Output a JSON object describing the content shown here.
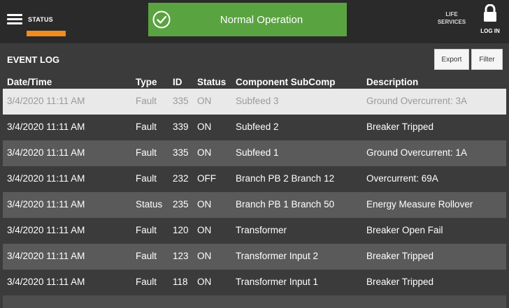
{
  "header": {
    "status_label": "STATUS",
    "banner_text": "Normal Operation",
    "life_services_line1": "LIFE",
    "life_services_line2": "SERVICES",
    "login_label": "LOG IN"
  },
  "colors": {
    "accent_orange": "#f28c1e",
    "status_green": "#5aa341",
    "background": "#3b3b3b",
    "row_alt": "#5a5a5a",
    "row_selected": "#e9e9e9"
  },
  "icons": {
    "menu": "menu-icon",
    "check": "check-circle-icon",
    "lock": "lock-icon"
  },
  "event_log": {
    "title": "EVENT LOG",
    "export_label": "Export",
    "filter_label": "Filter",
    "columns": {
      "datetime": "Date/Time",
      "type": "Type",
      "id": "ID",
      "status": "Status",
      "component": "Component SubComp",
      "description": "Description"
    },
    "rows": [
      {
        "datetime": "3/4/2020 11:11 AM",
        "type": "Fault",
        "id": "335",
        "status": "ON",
        "component": "Subfeed 3",
        "description": "Ground Overcurrent: 3A"
      },
      {
        "datetime": "3/4/2020 11:11 AM",
        "type": "Fault",
        "id": "339",
        "status": "ON",
        "component": "Subfeed 2",
        "description": "Breaker Tripped"
      },
      {
        "datetime": "3/4/2020 11:11 AM",
        "type": "Fault",
        "id": "335",
        "status": "ON",
        "component": "Subfeed 1",
        "description": "Ground Overcurrent: 1A"
      },
      {
        "datetime": "3/4/2020 11:11 AM",
        "type": "Fault",
        "id": "232",
        "status": "OFF",
        "component": "Branch PB 2 Branch 12",
        "description": "Overcurrent: 69A"
      },
      {
        "datetime": "3/4/2020 11:11 AM",
        "type": "Status",
        "id": "235",
        "status": "ON",
        "component": "Branch PB 1 Branch 50",
        "description": "Energy Measure Rollover"
      },
      {
        "datetime": "3/4/2020 11:11 AM",
        "type": "Fault",
        "id": "120",
        "status": "ON",
        "component": "Transformer",
        "description": "Breaker Open Fail"
      },
      {
        "datetime": "3/4/2020 11:11 AM",
        "type": "Fault",
        "id": "123",
        "status": "ON",
        "component": "Transformer Input 2",
        "description": "Breaker Tripped"
      },
      {
        "datetime": "3/4/2020 11:11 AM",
        "type": "Fault",
        "id": "118",
        "status": "ON",
        "component": "Transformer Input 1",
        "description": "Breaker Tripped"
      }
    ]
  }
}
